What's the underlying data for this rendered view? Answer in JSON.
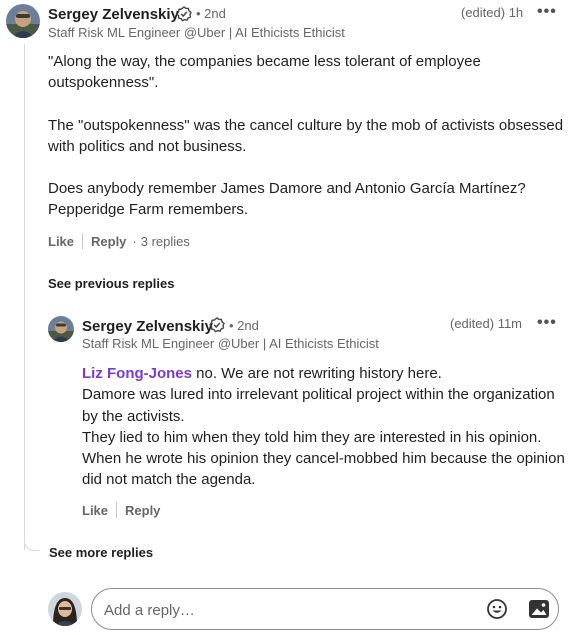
{
  "comment": {
    "author": "Sergey Zelvenskiy",
    "degree": "• 2nd",
    "headline": "Staff Risk ML Engineer @Uber | AI Ethicists Ethicist",
    "time": "(edited) 1h",
    "more": "•••",
    "paragraphs": [
      "\"Along the way, the companies became less tolerant of employee outspokenness\".",
      "The \"outspokenness\" was the cancel culture by the mob of activists obsessed with politics and not business.",
      "Does anybody remember James Damore and Antonio García Martínez? Pepperidge Farm remembers."
    ],
    "like_label": "Like",
    "reply_label": "Reply",
    "replies_count": "3 replies"
  },
  "see_previous_replies": "See previous replies",
  "reply": {
    "author": "Sergey Zelvenskiy",
    "degree": "• 2nd",
    "headline": "Staff Risk ML Engineer @Uber | AI Ethicists Ethicist",
    "time": "(edited) 11m",
    "more": "•••",
    "mention": "Liz Fong-Jones",
    "first_line_rest": " no. We are not rewriting history here.",
    "lines": [
      "Damore was lured into irrelevant political project within the organization by the activists.",
      "They lied to him when they told him they are interested in his opinion.",
      "When he wrote his opinion they cancel-mobbed him because the opinion did not match the agenda."
    ],
    "like_label": "Like",
    "reply_label": "Reply"
  },
  "see_more_replies": "See more replies",
  "composer": {
    "placeholder": "Add a reply…",
    "emoji_icon": "emoji-icon",
    "image_icon": "image-icon"
  },
  "colors": {
    "mention": "#7b3ad6",
    "muted": "#666666",
    "text": "#1f1f1f"
  }
}
